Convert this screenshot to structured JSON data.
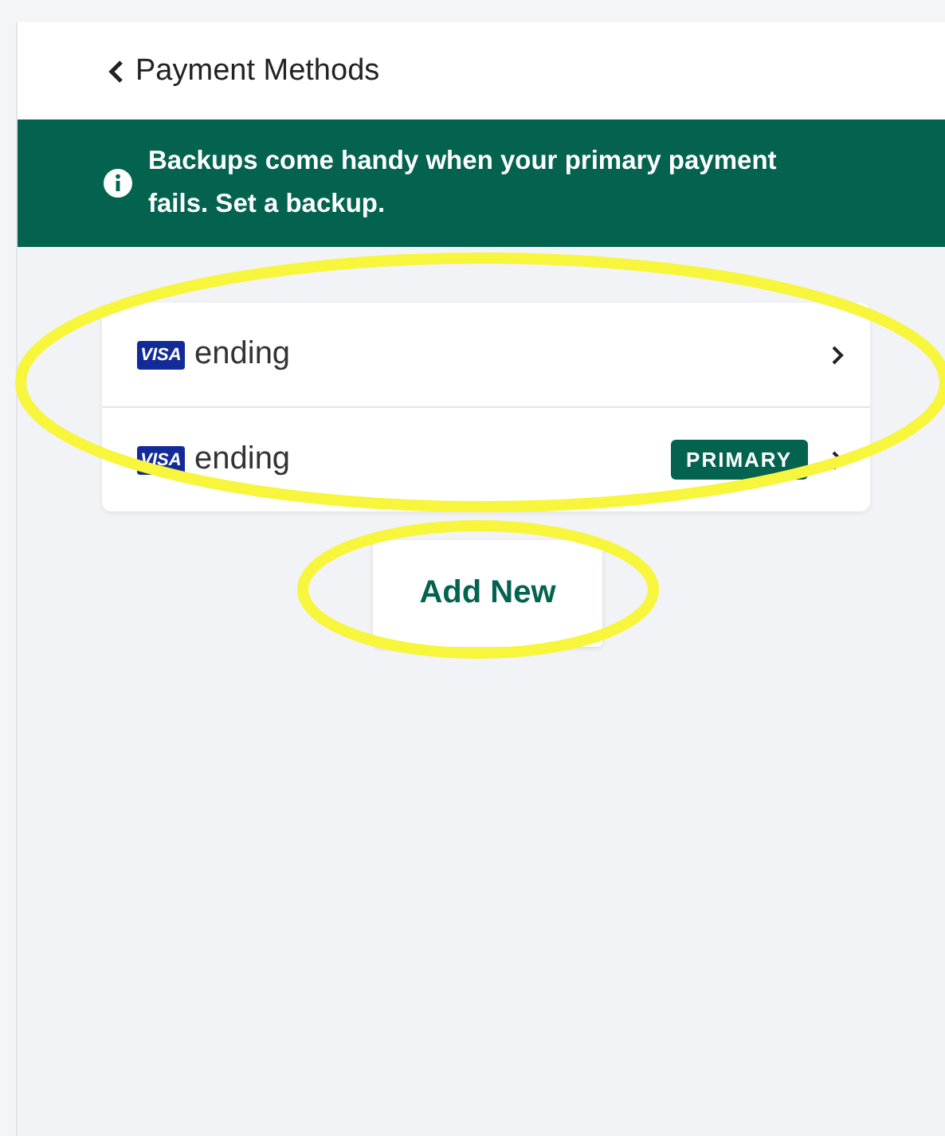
{
  "header": {
    "title": "Payment Methods"
  },
  "banner": {
    "text": "Backups come handy when your primary payment fails. Set a backup."
  },
  "primary_badge": "PRIMARY",
  "cards": [
    {
      "brand": "VISA",
      "label": "ending",
      "primary": false
    },
    {
      "brand": "VISA",
      "label": "ending",
      "primary": true
    }
  ],
  "add_button": {
    "label": "Add New"
  },
  "annotations": [
    {
      "kind": "ellipse"
    },
    {
      "kind": "ellipse"
    }
  ]
}
